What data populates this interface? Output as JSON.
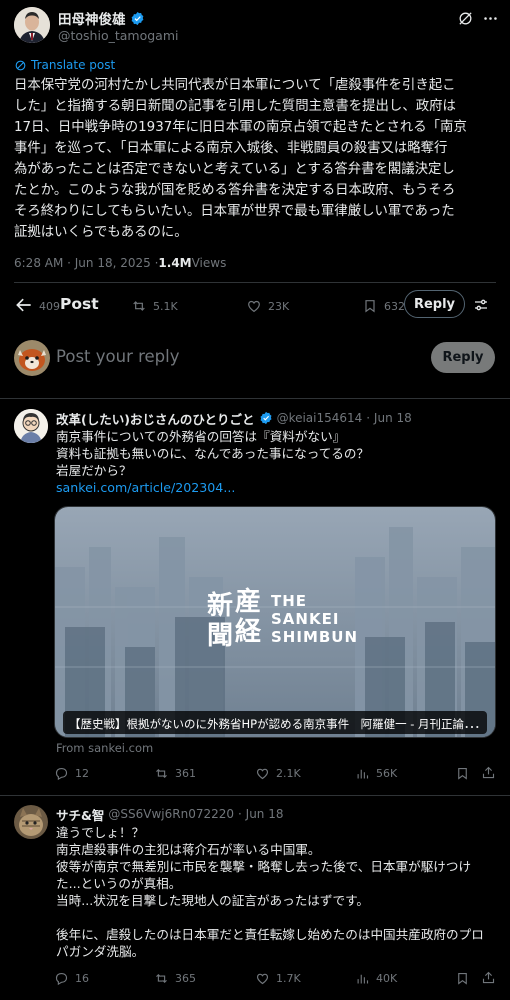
{
  "main_post": {
    "author_name": "田母神俊雄",
    "handle": "@toshio_tamogami",
    "translate_label": "Translate post",
    "text_lines": [
      "日本保守党の河村たかし共同代表が日本軍について「虐殺事件を引き起こ",
      "した」と指摘する朝日新聞の記事を引用した質問主意書を提出し、政府は",
      "17日、日中戦争時の1937年に旧日本軍の南京占領で起きたとされる「南京",
      "事件」を巡って、「日本軍による南京入城後、非戦闘員の殺害又は略奪行",
      "為があったことは否定できないと考えている」とする答弁書を閣議決定し",
      "たとか。このような我が国を貶める答弁書を決定する日本政府、もうそろ",
      "そろ終わりにしてもらいたい。日本軍が世界で最も軍律厳しい軍であった",
      "証拠はいくらでもあるのに。"
    ],
    "timestamp": "6:28 AM · Jun 18, 2025 · ",
    "views_count": "1.4M",
    "views_label": " Views",
    "stats": {
      "replies": "409",
      "reposts": "5.1K",
      "likes": "23K",
      "bookmarks": "632"
    },
    "sticky_label": "Post",
    "reply_button": "Reply"
  },
  "composer": {
    "placeholder": "Post your reply",
    "reply_button": "Reply"
  },
  "replies": [
    {
      "author_name": "改革(したい)おじさんのひとりごと",
      "handle": "@keiai154614",
      "date": "· Jun 18",
      "text_lines": [
        "南京事件についての外務省の回答は『資料がない』",
        "資料も証拠も無いのに、なんであった事になってるの？",
        "岩屋だから？"
      ],
      "link": "sankei.com/article/202304...",
      "card": {
        "logo_kanji_1": "産経",
        "logo_kanji_2": "新聞",
        "logo_line_1": "THE",
        "logo_line_2": "SANKEI",
        "logo_line_3": "SHIMBUN",
        "caption": "【歴史戦】根拠がないのに外務省HPが認める南京事件　阿羅健一 - 月刊正論オ...",
        "source": "From sankei.com"
      },
      "stats": {
        "replies": "12",
        "reposts": "361",
        "likes": "2.1K",
        "views": "56K"
      }
    },
    {
      "author_name": "サチ&智",
      "handle": "@SS6Vwj6Rn072220",
      "date": "· Jun 18",
      "text_lines": [
        "違うでしょ！？",
        "南京虐殺事件の主犯は蒋介石が率いる中国軍。",
        "彼等が南京で無差別に市民を襲撃・略奪し去った後で、日本軍が駆けつけ",
        "た...というのが真相。",
        "当時...状況を目撃した現地人の証言があったはずです。",
        "",
        "後年に、虐殺したのは日本軍だと責任転嫁し始めたのは中国共産政府のプロ",
        "パガンダ洗脳。"
      ],
      "stats": {
        "replies": "16",
        "reposts": "365",
        "likes": "1.7K",
        "views": "40K"
      }
    }
  ],
  "colors": {
    "accent": "#1d9bf0",
    "muted": "#71767b",
    "divider": "#2f3336"
  },
  "icons": [
    "verified-badge-icon",
    "grok-icon",
    "more-icon",
    "translate-icon",
    "reply-icon",
    "repost-icon",
    "like-icon",
    "bookmark-icon",
    "share-icon",
    "views-icon",
    "back-arrow-icon",
    "adjust-icon"
  ]
}
